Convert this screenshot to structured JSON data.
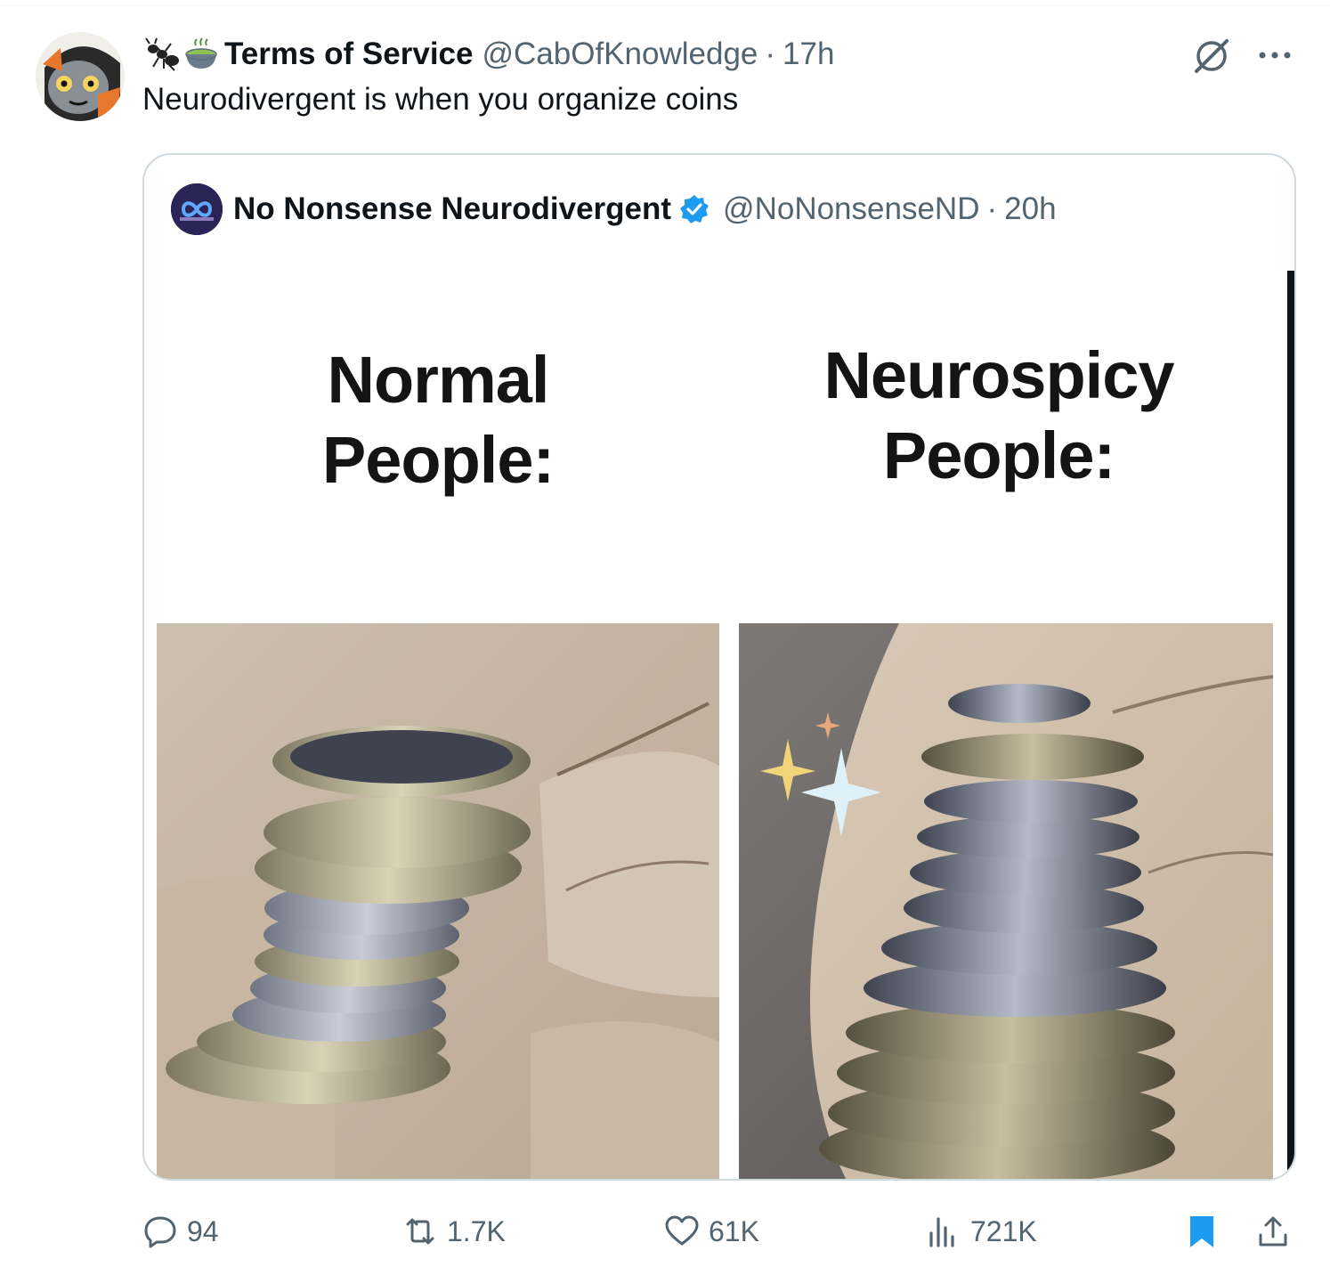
{
  "tweet": {
    "author": {
      "display_name": "Terms of Service",
      "handle": "@CabOfKnowledge",
      "separator": "·",
      "time": "17h",
      "emoji_icons": [
        "ant-icon",
        "matcha-bowl-icon"
      ]
    },
    "text": "Neurodivergent is when you organize coins",
    "top_actions": [
      "grok-icon",
      "more-icon"
    ]
  },
  "quoted": {
    "display_name": "No Nonsense Neurodivergent",
    "verified": true,
    "handle": "@NoNonsenseND",
    "separator": "·",
    "time": "20h",
    "meme": {
      "left_caption": "Normal\nPeople:",
      "right_caption": "Neurospicy\nPeople:"
    }
  },
  "actions": {
    "replies": "94",
    "reposts": "1.7K",
    "likes": "61K",
    "views": "721K"
  },
  "colors": {
    "text": "#0f1419",
    "secondary": "#536471",
    "verified": "#1d9bf0",
    "bookmark": "#1d9bf0",
    "border": "#cfd9de"
  }
}
